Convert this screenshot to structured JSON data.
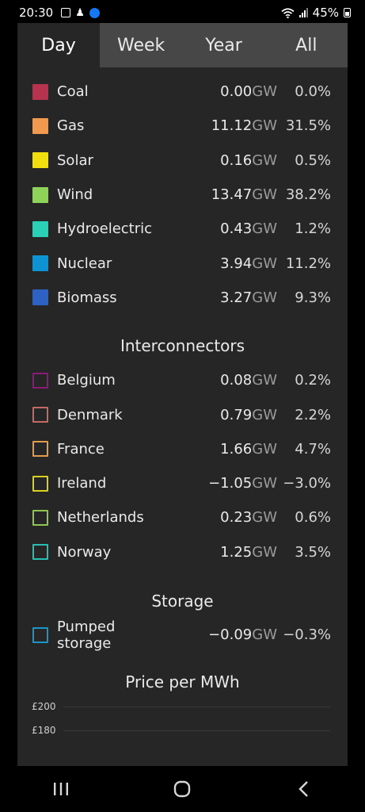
{
  "status": {
    "time": "20:30",
    "battery": "45%"
  },
  "tabs": [
    {
      "label": "Day",
      "active": true
    },
    {
      "label": "Week",
      "active": false
    },
    {
      "label": "Year",
      "active": false
    },
    {
      "label": "All",
      "active": false
    }
  ],
  "unit": "GW",
  "generation": [
    {
      "name": "Coal",
      "value": "0.00",
      "pct": "0.0%",
      "color": "#b5334f"
    },
    {
      "name": "Gas",
      "value": "11.12",
      "pct": "31.5%",
      "color": "#f0994f"
    },
    {
      "name": "Solar",
      "value": "0.16",
      "pct": "0.5%",
      "color": "#f1de0f"
    },
    {
      "name": "Wind",
      "value": "13.47",
      "pct": "38.2%",
      "color": "#8fd25a"
    },
    {
      "name": "Hydroelectric",
      "value": "0.43",
      "pct": "1.2%",
      "color": "#2ad1b7"
    },
    {
      "name": "Nuclear",
      "value": "3.94",
      "pct": "11.2%",
      "color": "#0d93d3"
    },
    {
      "name": "Biomass",
      "value": "3.27",
      "pct": "9.3%",
      "color": "#2d62c4"
    }
  ],
  "interconnectors": {
    "title": "Interconnectors",
    "items": [
      {
        "name": "Belgium",
        "value": "0.08",
        "pct": "0.2%",
        "color": "#8c1a7a"
      },
      {
        "name": "Denmark",
        "value": "0.79",
        "pct": "2.2%",
        "color": "#c46a66"
      },
      {
        "name": "France",
        "value": "1.66",
        "pct": "4.7%",
        "color": "#e59a4c"
      },
      {
        "name": "Ireland",
        "value": "−1.05",
        "pct": "−3.0%",
        "color": "#d9d01f"
      },
      {
        "name": "Netherlands",
        "value": "0.23",
        "pct": "0.6%",
        "color": "#8fc650"
      },
      {
        "name": "Norway",
        "value": "1.25",
        "pct": "3.5%",
        "color": "#27bfb1"
      }
    ]
  },
  "storage": {
    "title": "Storage",
    "items": [
      {
        "name": "Pumped storage",
        "value": "−0.09",
        "pct": "−0.3%",
        "color": "#1996c9"
      }
    ]
  },
  "price": {
    "title": "Price per MWh",
    "ticks": [
      "£200",
      "£180"
    ]
  }
}
